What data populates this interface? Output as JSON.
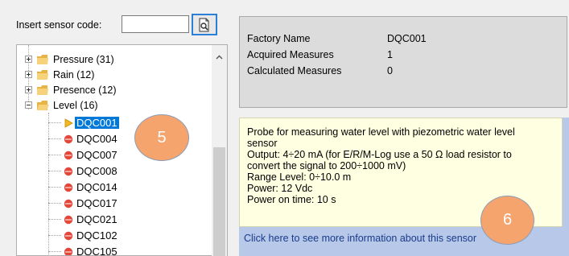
{
  "search": {
    "label": "Insert sensor code:",
    "value": "",
    "button_icon": "search-document-icon"
  },
  "tree": {
    "categories": [
      {
        "label": "Pressure (31)",
        "expanded": false
      },
      {
        "label": "Rain (12)",
        "expanded": false
      },
      {
        "label": "Presence (12)",
        "expanded": false
      },
      {
        "label": "Level (16)",
        "expanded": true
      }
    ],
    "items": [
      {
        "label": "DQC001",
        "selected": true,
        "icon": "play-arrow-icon"
      },
      {
        "label": "DQC004",
        "selected": false,
        "icon": "red-dot-icon"
      },
      {
        "label": "DQC007",
        "selected": false,
        "icon": "red-dot-icon"
      },
      {
        "label": "DQC008",
        "selected": false,
        "icon": "red-dot-icon"
      },
      {
        "label": "DQC014",
        "selected": false,
        "icon": "red-dot-icon"
      },
      {
        "label": "DQC017",
        "selected": false,
        "icon": "red-dot-icon"
      },
      {
        "label": "DQC021",
        "selected": false,
        "icon": "red-dot-icon"
      },
      {
        "label": "DQC102",
        "selected": false,
        "icon": "red-dot-icon"
      },
      {
        "label": "DQC105",
        "selected": false,
        "icon": "red-dot-icon"
      }
    ]
  },
  "info": {
    "rows": [
      {
        "key": "Factory Name",
        "value": "DQC001"
      },
      {
        "key": "Acquired Measures",
        "value": "1"
      },
      {
        "key": "Calculated Measures",
        "value": "0"
      }
    ]
  },
  "description": {
    "lines": [
      "Probe for measuring water level with piezometric water level",
      "sensor",
      "Output: 4÷20 mA (for E/R/M-Log use a 50 Ω load resistor to",
      "convert the signal to 200÷1000 mV)",
      "Range Level: 0÷10.0 m",
      "Power: 12 Vdc",
      "Power on time: 10 s"
    ],
    "link": "Click here to see more information about this sensor"
  },
  "annotations": {
    "badge_5": "5",
    "badge_6": "6"
  },
  "colors": {
    "selection": "#0078d7",
    "badge": "#f6a46e",
    "desc_bg": "#ffffe1",
    "panel_bg": "#b7c8e9",
    "leaf_dot": "#e5463a",
    "selected_arrow": "#f2b81d"
  }
}
